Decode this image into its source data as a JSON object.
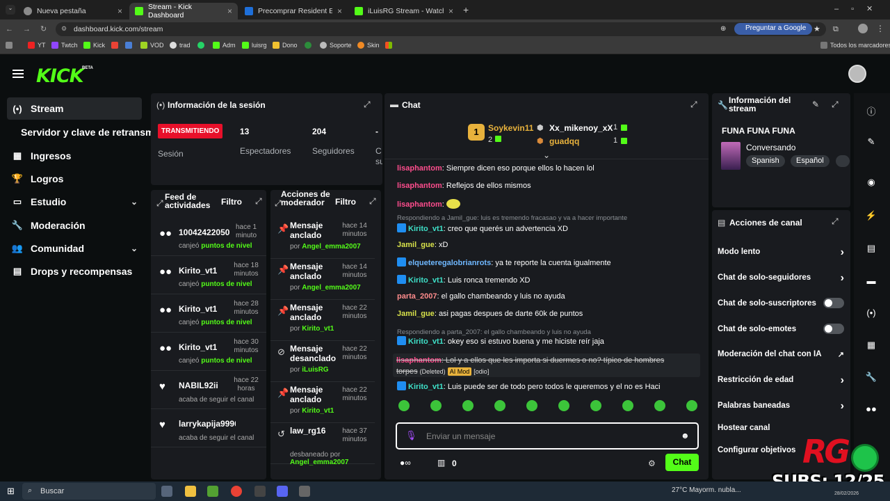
{
  "browser": {
    "tabs": [
      {
        "title": "Nueva pestaña",
        "color": "#8a8a8a"
      },
      {
        "title": "Stream - Kick Dashboard",
        "color": "#53fc18"
      },
      {
        "title": "Precomprar Resident Evil Requ",
        "color": "#1e6fd9"
      },
      {
        "title": "iLuisRG Stream - Watch Live on",
        "color": "#53fc18"
      }
    ],
    "url": "dashboard.kick.com/stream",
    "google_btn": "Preguntar a Google",
    "bookmarks": [
      "YT",
      "Twtch",
      "Kick",
      "",
      "",
      "VOD",
      "trad",
      "",
      "Adm",
      "luisrg",
      "Dono",
      "",
      "Soporte",
      "Skin",
      ""
    ],
    "all_bookmarks": "Todos los marcadores"
  },
  "app": {
    "logo": "KICK",
    "beta": "BETA",
    "nav": [
      {
        "label": "Stream",
        "icon": "(•)"
      },
      {
        "label": "Servidor y clave de retransm",
        "icon": ""
      },
      {
        "label": "Ingresos",
        "icon": "▦"
      },
      {
        "label": "Logros",
        "icon": "🏆"
      },
      {
        "label": "Estudio",
        "icon": "▭",
        "chev": "⌄"
      },
      {
        "label": "Moderación",
        "icon": "🔧"
      },
      {
        "label": "Comunidad",
        "icon": "👥",
        "chev": "⌄"
      },
      {
        "label": "Drops y recompensas",
        "icon": "▤"
      }
    ]
  },
  "session": {
    "title": "Información de la sesión",
    "status": "TRANSMITIENDO",
    "status_label": "Sesión",
    "viewers": "13",
    "viewers_label": "Espectadores",
    "followers": "204",
    "followers_label": "Seguidores",
    "extra": "-",
    "extra_label": "C",
    "extra_sub": "su"
  },
  "feed": {
    "title": "Feed de actividades",
    "filter": "Filtro",
    "items": [
      {
        "name": "10042422050",
        "time": "hace 1 minuto",
        "action": "canjeó",
        "reward": "puntos de nivel",
        "icon": "●●"
      },
      {
        "name": "Kirito_vt1",
        "time": "hace 18 minutos",
        "action": "canjeó",
        "reward": "puntos de nivel",
        "icon": "●●"
      },
      {
        "name": "Kirito_vt1",
        "time": "hace 28 minutos",
        "action": "canjeó",
        "reward": "puntos de nivel",
        "icon": "●●"
      },
      {
        "name": "Kirito_vt1",
        "time": "hace 30 minutos",
        "action": "canjeó",
        "reward": "puntos de nivel",
        "icon": "●●"
      },
      {
        "name": "NABIL92ii",
        "time": "hace 22 horas",
        "action": "acaba de seguir el canal",
        "reward": "",
        "icon": "♥"
      },
      {
        "name": "larrykapija9996612:",
        "time": "",
        "action": "acaba de seguir el canal",
        "reward": "",
        "icon": "♥"
      }
    ]
  },
  "mod": {
    "title": "Acciones de moderador",
    "filter": "Filtro",
    "items": [
      {
        "title": "Mensaje anclado",
        "time": "hace 14 minutos",
        "by": "por",
        "user": "Angel_emma2007",
        "icon": "📌"
      },
      {
        "title": "Mensaje anclado",
        "time": "hace 14 minutos",
        "by": "por",
        "user": "Angel_emma2007",
        "icon": "📌"
      },
      {
        "title": "Mensaje anclado",
        "time": "hace 22 minutos",
        "by": "por",
        "user": "Kirito_vt1",
        "icon": "📌"
      },
      {
        "title": "Mensaje desanclado",
        "time": "hace 22 minutos",
        "by": "por",
        "user": "iLuisRG",
        "icon": "⊘"
      },
      {
        "title": "Mensaje anclado",
        "time": "hace 22 minutos",
        "by": "por",
        "user": "Kirito_vt1",
        "icon": "📌"
      },
      {
        "title": "law_rg16",
        "time": "hace 37 minutos",
        "by": "desbaneado por",
        "user": "Angel_emma2007",
        "icon": "↺"
      }
    ]
  },
  "chat": {
    "title": "Chat",
    "top": [
      {
        "rank": "1",
        "name": "Soykevin11",
        "count": "2",
        "color": "#e8b23c"
      },
      {
        "rank": "2",
        "name": "Xx_mikenoy_xX",
        "count": "1",
        "color": "#ffffff"
      },
      {
        "rank": "3",
        "name": "guadqq",
        "count": "1",
        "color": "#e8b23c"
      }
    ],
    "messages": [
      {
        "user": "lisaphantom",
        "color": "#ff4d8d",
        "text": "Siempre dicen eso porque ellos lo hacen lol",
        "badge": false
      },
      {
        "user": "lisaphantom",
        "color": "#ff4d8d",
        "text": "Reflejos de ellos mismos",
        "badge": false
      },
      {
        "user": "lisaphantom",
        "color": "#ff4d8d",
        "text": "",
        "badge": false
      },
      {
        "user": "Kirito_vt1",
        "color": "#3ee0c8",
        "text": "creo que querés un advertencia XD",
        "badge": true
      },
      {
        "user": "Jamil_gue",
        "color": "#d8e24a",
        "text": "xD",
        "badge": false
      },
      {
        "user": "elqueteregalobrianrots",
        "color": "#6fb8ff",
        "text": "ya te reporte la cuenta igualmente",
        "badge": true
      },
      {
        "user": "Kirito_vt1",
        "color": "#3ee0c8",
        "text": "Luis ronca tremendo XD",
        "badge": true
      },
      {
        "user": "parta_2007",
        "color": "#ff8c8c",
        "text": "el gallo chambeando y luis no ayuda",
        "badge": false
      },
      {
        "user": "Jamil_gue",
        "color": "#d8e24a",
        "text": "asi pagas despues de darte 60k de puntos",
        "badge": false
      },
      {
        "user": "Kirito_vt1",
        "color": "#3ee0c8",
        "text": "okey eso si estuvo buena y me hiciste reír jaja",
        "badge": true
      },
      {
        "user": "Kirito_vt1",
        "color": "#3ee0c8",
        "text": "Luis puede ser de todo pero todos le queremos y el no es Haci",
        "badge": true
      }
    ],
    "replies": [
      "Respondiendo a Jamil_gue: luis es tremendo fracasao y va a hacer importante",
      "Respondiendo a parta_2007: el gallo chambeando y luis no ayuda"
    ],
    "deleted": {
      "user": "lisaphantom",
      "text": "Lol y a ellos que les importa si duermes o no? típico de hombres",
      "text2": "torpes",
      "tag": "(Deleted)",
      "ai": "AI Mod",
      "reason": "[odio]"
    },
    "placeholder": "Enviar un mensaje",
    "points": "0",
    "send": "Chat"
  },
  "streaminfo": {
    "title": "Información del stream",
    "name": "FUNA FUNA FUNA",
    "category": "Conversando",
    "tags": [
      "Spanish",
      "Español"
    ]
  },
  "channel": {
    "title": "Acciones de canal",
    "rows": [
      {
        "label": "Modo lento",
        "ctrl": "arrow"
      },
      {
        "label": "Chat de solo-seguidores",
        "ctrl": "arrow"
      },
      {
        "label": "Chat de solo-suscriptores",
        "ctrl": "toggle"
      },
      {
        "label": "Chat de solo-emotes",
        "ctrl": "toggle"
      },
      {
        "label": "Moderación del chat con IA",
        "ctrl": "ext"
      },
      {
        "label": "Restricción de edad",
        "ctrl": "arrow"
      },
      {
        "label": "Palabras baneadas",
        "ctrl": "arrow"
      },
      {
        "label": "Hostear canal",
        "ctrl": "none"
      },
      {
        "label": "Configurar objetivos",
        "ctrl": "arrow"
      }
    ]
  },
  "overlay": {
    "subs": "SUBS: 12/25",
    "logo": "RG"
  },
  "taskbar": {
    "search": "Buscar",
    "weather": "27°C  Mayorm. nubla...",
    "date": "28/02/2026"
  }
}
